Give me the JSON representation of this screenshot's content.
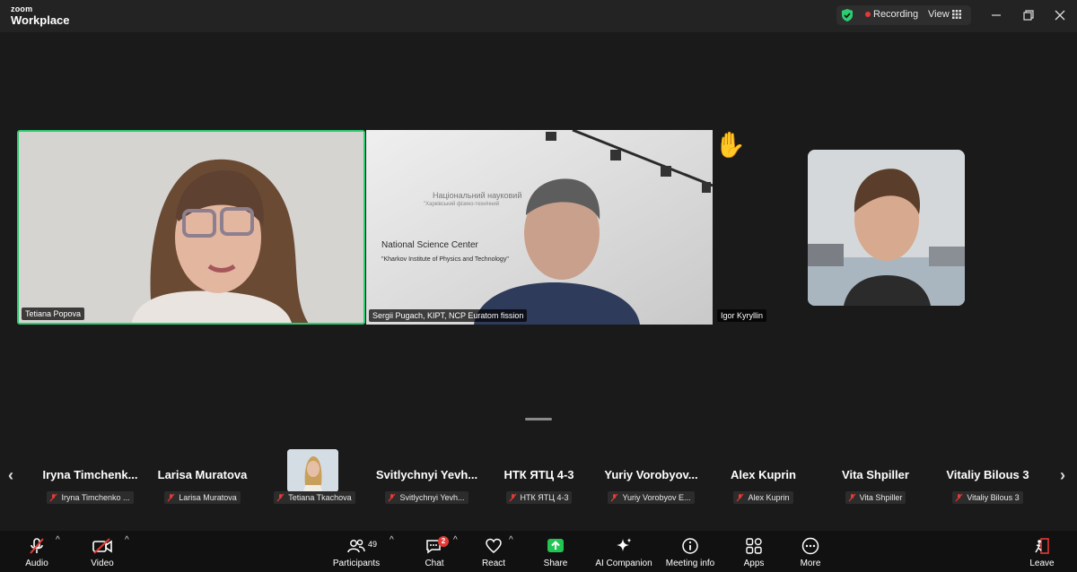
{
  "app": {
    "brand_small": "zoom",
    "brand_large": "Workplace"
  },
  "titlebar": {
    "recording_label": "Recording",
    "view_label": "View"
  },
  "colors": {
    "active_speaker": "#2ecc71",
    "recording": "#e53935",
    "shield": "#2ecc71",
    "share": "#23c552",
    "badge": "#e53935"
  },
  "tiles": [
    {
      "name": "Tetiana Popova",
      "active_speaker": true
    },
    {
      "name": "Sergii Pugach, KIPT, NCP Euratom fission",
      "sign_line1": "National Science Center",
      "sign_line2": "\"Kharkov Institute of Physics and Technology\"",
      "sign_ua1": "Національний науковий",
      "sign_ua2": "\"Харківський фізико-технічний"
    },
    {
      "name": "Igor Kyryllin",
      "raised_hand": true
    }
  ],
  "gallery": [
    {
      "title": "Iryna  Timchenk...",
      "tag": "Iryna Timchenko ..."
    },
    {
      "title": "Larisa Muratova",
      "tag": "Larisa Muratova"
    },
    {
      "title": "",
      "tag": "Tetiana Tkachova",
      "has_photo": true
    },
    {
      "title": "Svitlychnyi  Yevh...",
      "tag": "Svitlychnyi Yevh..."
    },
    {
      "title": "НТК ЯТЦ 4-3",
      "tag": "НТК ЯТЦ 4-3"
    },
    {
      "title": "Yuriy  Vorobyov...",
      "tag": "Yuriy Vorobyov E..."
    },
    {
      "title": "Alex Kuprin",
      "tag": "Alex Kuprin"
    },
    {
      "title": "Vita Shpiller",
      "tag": "Vita Shpiller"
    },
    {
      "title": "Vitaliy Bilous 3",
      "tag": "Vitaliy Bilous 3"
    }
  ],
  "toolbar": {
    "audio": "Audio",
    "video": "Video",
    "participants": "Participants",
    "participants_count": "49",
    "chat": "Chat",
    "chat_badge": "2",
    "react": "React",
    "share": "Share",
    "ai_companion": "AI Companion",
    "meeting_info": "Meeting info",
    "apps": "Apps",
    "more": "More",
    "leave": "Leave"
  }
}
